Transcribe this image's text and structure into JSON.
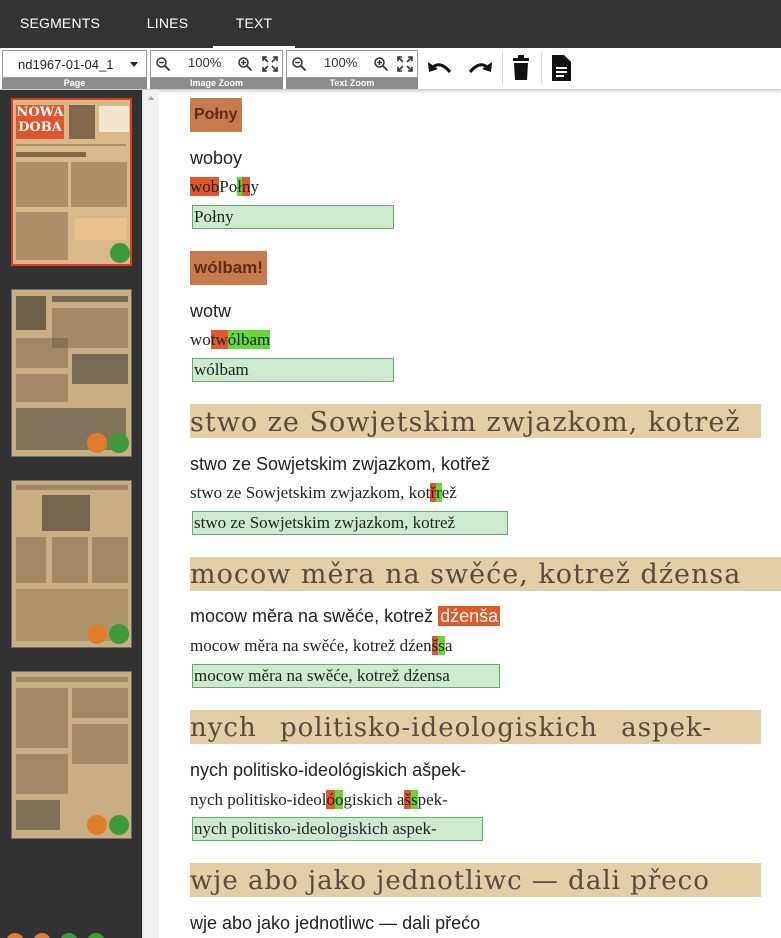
{
  "tabs": [
    {
      "label": "SEGMENTS",
      "active": false
    },
    {
      "label": "LINES",
      "active": false
    },
    {
      "label": "TEXT",
      "active": true
    }
  ],
  "toolbar": {
    "page_value": "nd1967-01-04_1",
    "page_label": "Page",
    "image_zoom_value": "100%",
    "image_zoom_label": "Image Zoom",
    "text_zoom_value": "100%",
    "text_zoom_label": "Text Zoom"
  },
  "thumbnails": [
    {
      "headline": "NOWA DOBA",
      "selected": true,
      "badges": [
        "green"
      ]
    },
    {
      "headline": "",
      "selected": false,
      "badges": [
        "orange",
        "green"
      ]
    },
    {
      "headline": "",
      "selected": false,
      "badges": [
        "orange",
        "green"
      ]
    },
    {
      "headline": "",
      "selected": false,
      "badges": [
        "orange",
        "green"
      ]
    }
  ],
  "colors": {
    "topbar": "#333333",
    "sidebar": "#323232",
    "error": "#e0592a",
    "correction": "#62d93a",
    "ground_truth_bg": "#cdeacf",
    "ground_truth_border": "#5fae6b",
    "status_green": "#3f9a3a",
    "status_orange": "#e07d2a"
  },
  "lines": [
    {
      "image_text": "Połny",
      "ocr": "woboy",
      "diff": [
        {
          "t": "wob",
          "k": "r"
        },
        {
          "t": "Po"
        },
        {
          "t": "ł",
          "k": "g"
        },
        {
          "t": "n",
          "k": "r"
        },
        {
          "t": "y"
        }
      ],
      "ground_truth": "Połny"
    },
    {
      "image_text": "wólbam!",
      "ocr": "wotw",
      "diff": [
        {
          "t": "wo"
        },
        {
          "t": "tw",
          "k": "r"
        },
        {
          "t": "ólbam",
          "k": "g"
        }
      ],
      "ground_truth": "wólbam"
    },
    {
      "image_text": "stwo ze Sowjetskim zwjazkom, kotrež",
      "ocr": "stwo ze Sowjetskim zwjazkom, kotřež",
      "diff": [
        {
          "t": "stwo ze Sowjetskim zwjazkom, kot"
        },
        {
          "t": "ř",
          "k": "r"
        },
        {
          "t": "r",
          "k": "g"
        },
        {
          "t": "ež"
        }
      ],
      "ground_truth": "stwo ze Sowjetskim zwjazkom, kotrež"
    },
    {
      "image_text": "mocow měra na swěće, kotrež dźensa",
      "ocr_parts": [
        {
          "t": "mocow měra na swěće, kotrež "
        },
        {
          "t": "dźenša",
          "k": "rs"
        }
      ],
      "diff": [
        {
          "t": "mocow měra na swěće, kotrež dźen"
        },
        {
          "t": "š",
          "k": "r"
        },
        {
          "t": "s",
          "k": "g"
        },
        {
          "t": "a"
        }
      ],
      "ground_truth": "mocow měra na swěće, kotrež dźensa"
    },
    {
      "image_text": "nych politisko-ideologiskich aspek-",
      "ocr": "nych politisko-ideológiskich ašpek-",
      "diff": [
        {
          "t": "nych politisko-ideol"
        },
        {
          "t": "ó",
          "k": "r"
        },
        {
          "t": "o",
          "k": "g"
        },
        {
          "t": "giskich a"
        },
        {
          "t": "š",
          "k": "r"
        },
        {
          "t": "s",
          "k": "g"
        },
        {
          "t": "pek-"
        }
      ],
      "ground_truth": "nych politisko-ideologiskich aspek-"
    },
    {
      "image_text": "wje abo jako jednotliwc — dali přeco",
      "ocr": "wje abo jako jednotliwc — dali přećo"
    }
  ]
}
